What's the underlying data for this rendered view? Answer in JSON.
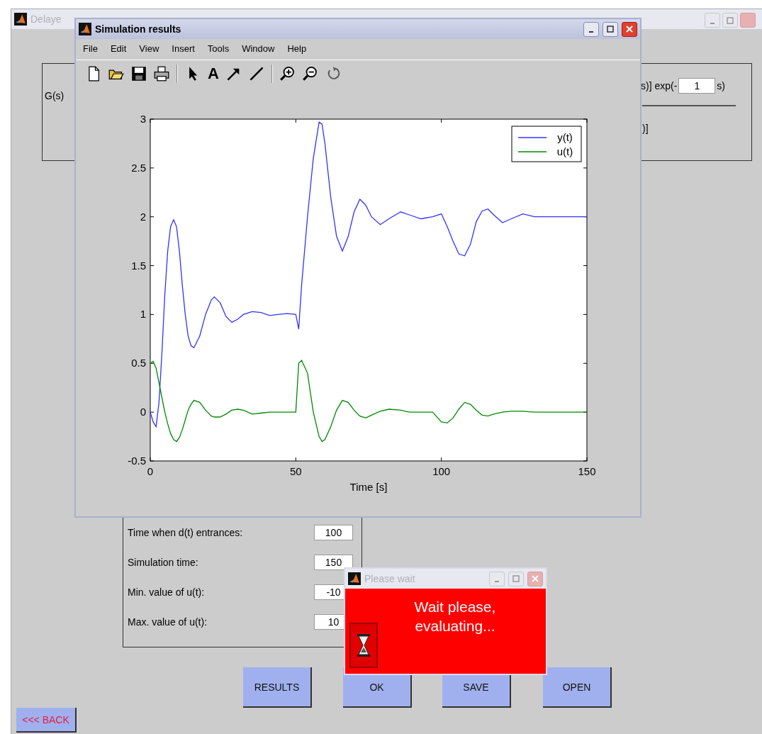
{
  "back_window": {
    "title": "Delaye",
    "top_panel": {
      "left_label": "G(s)",
      "right_text_1": "s)] exp(-",
      "delay_field": "1",
      "right_text_2": "s)",
      "right_text_3": ")]"
    },
    "parameters": [
      {
        "label": "Time when d(t) entrances:",
        "value": "100"
      },
      {
        "label": "Simulation time:",
        "value": "150"
      },
      {
        "label": "Min. value of u(t):",
        "value": "-10"
      },
      {
        "label": "Max. value of u(t):",
        "value": "10"
      }
    ],
    "buttons": [
      "RESULTS",
      "OK",
      "SAVE",
      "OPEN"
    ],
    "back_button": "<<< BACK"
  },
  "results_window": {
    "title": "Simulation results",
    "menu": [
      "File",
      "Edit",
      "View",
      "Insert",
      "Tools",
      "Window",
      "Help"
    ],
    "toolbar": [
      {
        "kind": "new"
      },
      {
        "kind": "open"
      },
      {
        "kind": "save"
      },
      {
        "kind": "print"
      },
      {
        "kind": "select"
      },
      {
        "kind": "text",
        "label": "A"
      },
      {
        "kind": "arrow"
      },
      {
        "kind": "line"
      },
      {
        "kind": "zoom-in"
      },
      {
        "kind": "zoom-out"
      },
      {
        "kind": "rotate"
      }
    ],
    "chart_data": {
      "type": "line",
      "legend": "upper right",
      "xlabel": "Time [s]",
      "xlim": [
        0,
        150
      ],
      "ylim": [
        -0.5,
        3
      ],
      "xticks": [
        0,
        50,
        100,
        150
      ],
      "yticks": [
        -0.5,
        0,
        0.5,
        1,
        1.5,
        2,
        2.5,
        3
      ],
      "x": [
        0,
        1,
        2,
        3,
        4,
        5,
        6,
        7,
        8,
        9,
        10,
        11,
        12,
        13,
        14,
        15,
        17,
        19,
        21,
        22,
        24,
        26,
        28,
        30,
        32,
        35,
        38,
        41,
        44,
        47,
        50,
        51,
        52,
        54,
        56,
        58,
        59,
        60,
        62,
        64,
        66,
        68,
        70,
        72,
        74,
        76,
        79,
        82,
        86,
        89,
        93,
        97,
        100,
        102,
        104,
        106,
        108,
        110,
        112,
        114,
        116,
        118,
        121,
        124,
        128,
        132,
        140,
        150
      ],
      "series": [
        {
          "name": "y(t)",
          "color": "#3333ff",
          "values": [
            0,
            -0.1,
            -0.15,
            0.1,
            0.6,
            1.2,
            1.65,
            1.9,
            1.97,
            1.9,
            1.65,
            1.3,
            1.0,
            0.78,
            0.68,
            0.66,
            0.78,
            1.0,
            1.15,
            1.18,
            1.12,
            0.98,
            0.92,
            0.95,
            1.0,
            1.03,
            1.02,
            0.99,
            1.0,
            1.01,
            1.0,
            0.85,
            1.3,
            2.0,
            2.6,
            2.97,
            2.95,
            2.75,
            2.2,
            1.8,
            1.65,
            1.8,
            2.05,
            2.18,
            2.12,
            2.0,
            1.92,
            1.98,
            2.05,
            2.02,
            1.98,
            2.0,
            2.03,
            1.9,
            1.75,
            1.62,
            1.6,
            1.72,
            1.95,
            2.06,
            2.08,
            2.02,
            1.94,
            1.98,
            2.03,
            2.0,
            2.0,
            2.0
          ]
        },
        {
          "name": "u(t)",
          "color": "#008800",
          "values": [
            0.5,
            0.52,
            0.45,
            0.3,
            0.15,
            0.0,
            -0.12,
            -0.22,
            -0.28,
            -0.3,
            -0.26,
            -0.18,
            -0.08,
            0.02,
            0.08,
            0.12,
            0.1,
            0.02,
            -0.04,
            -0.05,
            -0.05,
            -0.02,
            0.02,
            0.03,
            0.02,
            -0.02,
            -0.01,
            0.0,
            0.0,
            0.0,
            0.0,
            0.5,
            0.53,
            0.4,
            0.0,
            -0.25,
            -0.3,
            -0.28,
            -0.15,
            0.02,
            0.12,
            0.1,
            0.02,
            -0.04,
            -0.06,
            -0.03,
            0.01,
            0.03,
            0.02,
            0.0,
            0.0,
            0.0,
            -0.1,
            -0.11,
            -0.06,
            0.03,
            0.1,
            0.08,
            0.02,
            -0.03,
            -0.04,
            -0.02,
            0.0,
            0.01,
            0.01,
            0.0,
            0.0,
            0.0
          ]
        }
      ]
    }
  },
  "wait_dialog": {
    "title": "Please wait",
    "message": "Wait please, evaluating..."
  }
}
